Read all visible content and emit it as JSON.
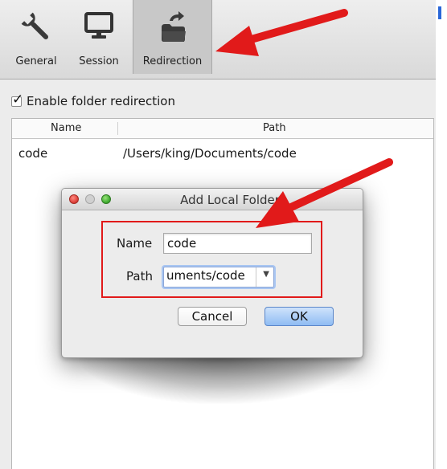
{
  "toolbar": {
    "tabs": [
      {
        "label": "General",
        "icon": "wrench-icon"
      },
      {
        "label": "Session",
        "icon": "monitor-icon"
      },
      {
        "label": "Redirection",
        "icon": "folder-redirect-icon",
        "selected": true
      }
    ]
  },
  "redirection": {
    "checkbox_label": "Enable folder redirection",
    "checkbox_checked": true,
    "table": {
      "columns": [
        "Name",
        "Path"
      ],
      "rows": [
        {
          "name": "code",
          "path": "/Users/king/Documents/code"
        }
      ]
    }
  },
  "dialog": {
    "title": "Add Local Folder",
    "name_label": "Name",
    "name_value": "code",
    "path_label": "Path",
    "path_value": "uments/code",
    "cancel_label": "Cancel",
    "ok_label": "OK"
  },
  "colors": {
    "annotation_red": "#e11a1a",
    "ok_button_blue": "#8fbcf3",
    "toolbar_selected": "#c8c8c8"
  }
}
